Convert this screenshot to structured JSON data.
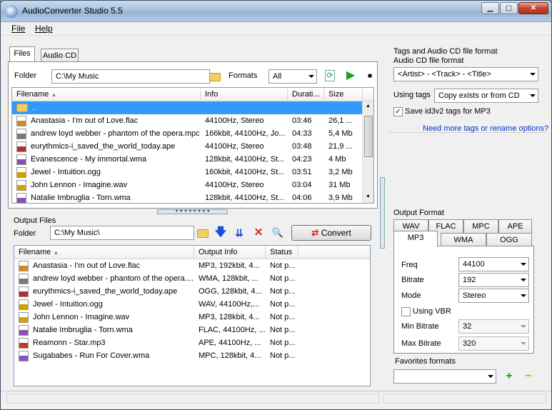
{
  "window": {
    "title": "AudioConverter Studio 5.5"
  },
  "menu": [
    "File",
    "Help"
  ],
  "left_tabs": [
    "Files",
    "Audio CD"
  ],
  "files": {
    "folder_label": "Folder",
    "folder_value": "C:\\My Music",
    "formats_label": "Formats",
    "formats_value": "All",
    "columns": [
      "Filename",
      "Info",
      "Durati...",
      "Size"
    ],
    "rows": [
      {
        "name": "..",
        "info": "",
        "dur": "",
        "size": "",
        "type": "folder",
        "color": "#f3cf5f"
      },
      {
        "name": "Anastasia - I'm out of Love.flac",
        "info": "44100Hz, Stereo",
        "dur": "03:46",
        "size": "26,1 ...",
        "type": "FLA",
        "color": "#d98a1c"
      },
      {
        "name": "andrew loyd webber - phantom of the opera.mpc",
        "info": "166kbit, 44100Hz, Jo...",
        "dur": "04:33",
        "size": "5,4 Mb",
        "type": "mpc",
        "color": "#7a7a7a"
      },
      {
        "name": "eurythmics-i_saved_the_world_today.ape",
        "info": "44100Hz, Stereo",
        "dur": "03:48",
        "size": "21,9 ...",
        "type": "ape",
        "color": "#b03030"
      },
      {
        "name": "Evanescence - My immortal.wma",
        "info": "128kbit, 44100Hz, St...",
        "dur": "04:23",
        "size": "4 Mb",
        "type": "wma",
        "color": "#8a4fb8"
      },
      {
        "name": "Jewel - Intuition.ogg",
        "info": "160kbit, 44100Hz, St...",
        "dur": "03:51",
        "size": "3,2 Mb",
        "type": "ogg",
        "color": "#d4a000"
      },
      {
        "name": "John Lennon - Imagine.wav",
        "info": "44100Hz, Stereo",
        "dur": "03:04",
        "size": "31 Mb",
        "type": "wav",
        "color": "#d4a000"
      },
      {
        "name": "Natalie Imbruglia - Torn.wma",
        "info": "128kbit, 44100Hz, St...",
        "dur": "04:06",
        "size": "3,9 Mb",
        "type": "wma",
        "color": "#8a4fb8"
      }
    ]
  },
  "output": {
    "section_label": "Output Files",
    "folder_label": "Folder",
    "folder_value": "C:\\My Music\\",
    "convert_label": "Convert",
    "columns": [
      "Filename",
      "Output Info",
      "Status"
    ],
    "rows": [
      {
        "name": "Anastasia - I'm out of Love.flac",
        "info": "MP3, 192kbit, 4...",
        "status": "Not p...",
        "type": "FLA",
        "color": "#d98a1c"
      },
      {
        "name": "andrew loyd webber - phantom of the opera....",
        "info": "WMA, 128kbit, ...",
        "status": "Not p...",
        "type": "mpc",
        "color": "#7a7a7a"
      },
      {
        "name": "eurythmics-i_saved_the_world_today.ape",
        "info": "OGG, 128kbit, 4...",
        "status": "Not p...",
        "type": "ape",
        "color": "#b03030"
      },
      {
        "name": "Jewel - Intuition.ogg",
        "info": "WAV, 44100Hz,...",
        "status": "Not p...",
        "type": "ogg",
        "color": "#d4a000"
      },
      {
        "name": "John Lennon - Imagine.wav",
        "info": "MP3, 128kbit, 4...",
        "status": "Not p...",
        "type": "wav",
        "color": "#d4a000"
      },
      {
        "name": "Natalie Imbruglia - Torn.wma",
        "info": "FLAC, 44100Hz, ...",
        "status": "Not p...",
        "type": "wma",
        "color": "#8a4fb8"
      },
      {
        "name": "Reamonn - Star.mp3",
        "info": "APE, 44100Hz, ...",
        "status": "Not p...",
        "type": "mp3",
        "color": "#c0392b"
      },
      {
        "name": "Sugababes - Run For Cover.wma",
        "info": "MPC, 128kbit, 4...",
        "status": "Not p...",
        "type": "wma",
        "color": "#8a4fb8"
      }
    ]
  },
  "tags": {
    "title": "Tags and Audio CD file format",
    "cd_format_label": "Audio CD file format",
    "cd_format_value": "<Artist> - <Track> - <Title>",
    "using_tags_label": "Using tags",
    "using_tags_value": "Copy exists or from CD",
    "save_id3_label": "Save id3v2 tags for MP3",
    "save_id3_checked": true,
    "link": "Need more tags or rename options?"
  },
  "format": {
    "title": "Output Format",
    "tabs_row1": [
      "WAV",
      "FLAC",
      "MPC",
      "APE"
    ],
    "tabs_row2": [
      "MP3",
      "WMA",
      "OGG"
    ],
    "active_tab": "MP3",
    "freq_label": "Freq",
    "freq_value": "44100",
    "bitrate_label": "Bitrate",
    "bitrate_value": "192",
    "mode_label": "Mode",
    "mode_value": "Stereo",
    "vbr_label": "Using VBR",
    "vbr_checked": false,
    "min_label": "Min Bitrate",
    "min_value": "32",
    "max_label": "Max Bitrate",
    "max_value": "320",
    "favorites_label": "Favorites formats",
    "favorites_value": ""
  }
}
